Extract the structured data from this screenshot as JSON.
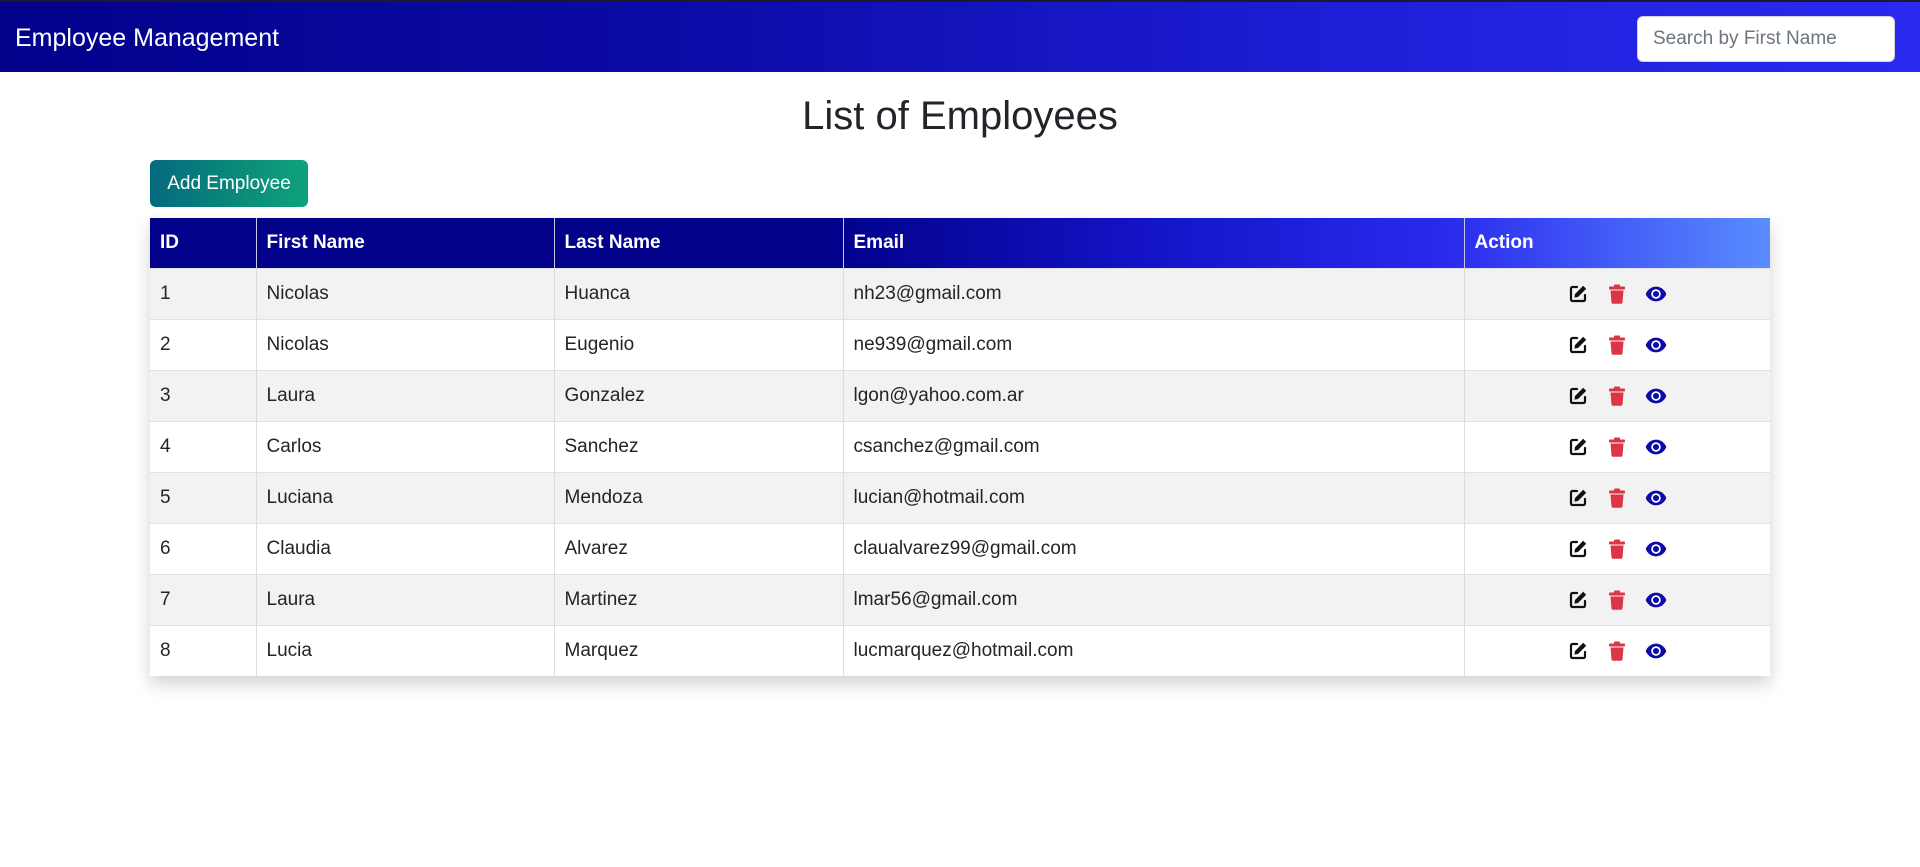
{
  "navbar": {
    "brand": "Employee Management",
    "search_placeholder": "Search by First Name",
    "search_value": ""
  },
  "page": {
    "title": "List of Employees",
    "add_button_label": "Add Employee"
  },
  "table": {
    "headers": {
      "id": "ID",
      "first_name": "First Name",
      "last_name": "Last Name",
      "email": "Email",
      "action": "Action"
    },
    "rows": [
      {
        "id": "1",
        "first_name": "Nicolas",
        "last_name": "Huanca",
        "email": "nh23@gmail.com"
      },
      {
        "id": "2",
        "first_name": "Nicolas",
        "last_name": "Eugenio",
        "email": "ne939@gmail.com"
      },
      {
        "id": "3",
        "first_name": "Laura",
        "last_name": "Gonzalez",
        "email": "lgon@yahoo.com.ar"
      },
      {
        "id": "4",
        "first_name": "Carlos",
        "last_name": "Sanchez",
        "email": "csanchez@gmail.com"
      },
      {
        "id": "5",
        "first_name": "Luciana",
        "last_name": "Mendoza",
        "email": "lucian@hotmail.com"
      },
      {
        "id": "6",
        "first_name": "Claudia",
        "last_name": "Alvarez",
        "email": "claualvarez99@gmail.com"
      },
      {
        "id": "7",
        "first_name": "Laura",
        "last_name": "Martinez",
        "email": "lmar56@gmail.com"
      },
      {
        "id": "8",
        "first_name": "Lucia",
        "last_name": "Marquez",
        "email": "lucmarquez@hotmail.com"
      }
    ],
    "action_icons": [
      "edit-icon",
      "trash-icon",
      "eye-icon"
    ]
  },
  "colors": {
    "navbar_start": "#01018a",
    "navbar_end": "#2a2af0",
    "add_button_start": "#046a7d",
    "add_button_end": "#0fa27c",
    "edit_icon": "#111111",
    "delete_icon": "#dc3545",
    "view_icon": "#0b0ba6"
  }
}
